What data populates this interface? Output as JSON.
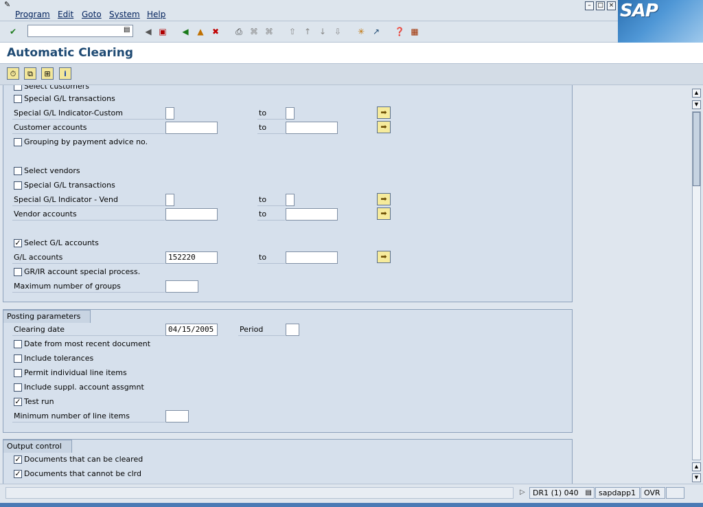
{
  "menu": {
    "items": [
      "Program",
      "Edit",
      "Goto",
      "System",
      "Help"
    ]
  },
  "toolbar": {
    "command_field_value": ""
  },
  "title": "Automatic Clearing",
  "vendors_section": {
    "select_customers_label": "Select customers",
    "cust_special_gl_transactions_label": "Special G/L transactions",
    "special_gl_indicator_custom_label": "Special G/L Indicator-Custom",
    "customer_accounts_label": "Customer accounts",
    "grouping_label": "Grouping by payment advice no.",
    "select_vendors_label": "Select vendors",
    "vend_special_gl_transactions_label": "Special G/L transactions",
    "special_gl_indicator_vend_label": "Special G/L Indicator - Vend",
    "vendor_accounts_label": "Vendor accounts",
    "select_gl_accounts_label": "Select G/L accounts",
    "gl_accounts_label": "G/L accounts",
    "gl_accounts_from": "152220",
    "grir_label": "GR/IR account special process.",
    "max_groups_label": "Maximum number of groups",
    "to_label": "to"
  },
  "posting_parameters": {
    "title": "Posting parameters",
    "clearing_date_label": "Clearing date",
    "clearing_date_value": "04/15/2005",
    "period_label": "Period",
    "period_value": "",
    "date_recent_label": "Date from most recent document",
    "include_tolerances_label": "Include tolerances",
    "permit_individual_label": "Permit individual line items",
    "include_suppl_label": "Include suppl. account assgmnt",
    "test_run_label": "Test run",
    "min_line_items_label": "Minimum number of line items"
  },
  "output_control": {
    "title": "Output control",
    "docs_can_clear_label": "Documents that can be cleared",
    "docs_cannot_clear_label": "Documents that cannot be clrd"
  },
  "status": {
    "system": "DR1 (1) 040",
    "server": "sapdapp1",
    "mode": "OVR"
  },
  "logo_text": "SAP"
}
